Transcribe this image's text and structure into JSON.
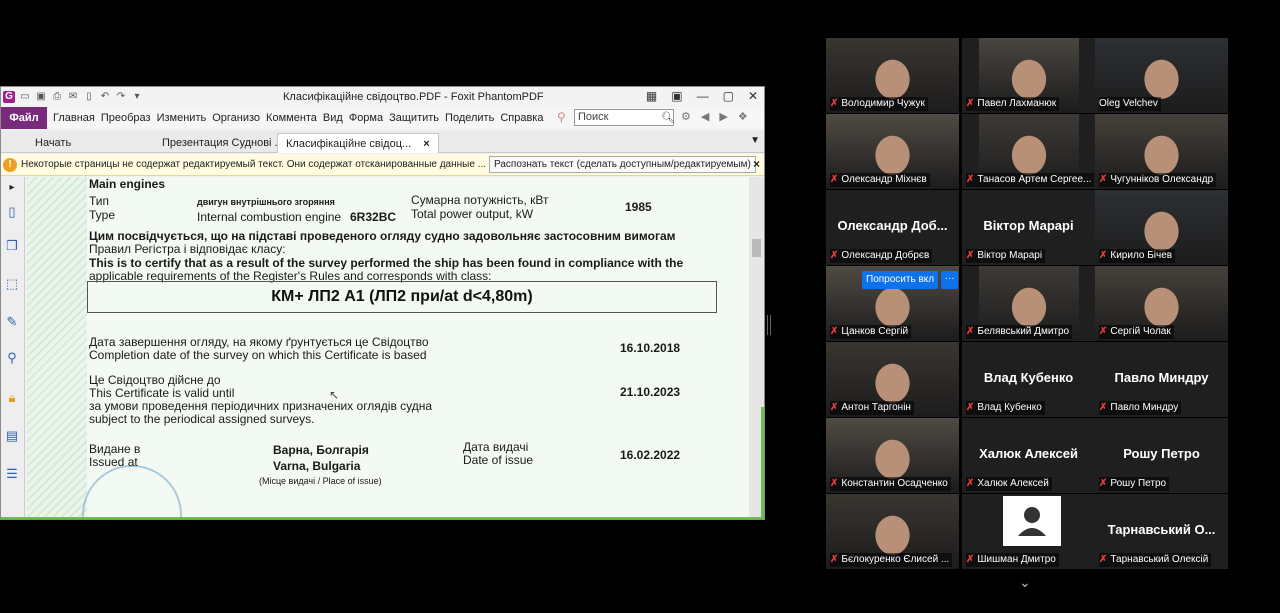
{
  "pdf_window": {
    "title": "Класифікаційне  свідоцтво.PDF - Foxit PhantomPDF",
    "menu": [
      "Файл",
      "Главная",
      "Преобраз",
      "Изменить",
      "Организо",
      "Коммента",
      "Вид",
      "Форма",
      "Защитить",
      "Поделить",
      "Справка"
    ],
    "search_placeholder": "Поиск",
    "tabs": [
      {
        "label": "Начать",
        "active": false
      },
      {
        "label": "Презентация Суднові ...",
        "active": false
      },
      {
        "label": "Класифікаційне  свідоц...",
        "active": true
      }
    ],
    "tab_close": "×",
    "infobar_text": "Некоторые страницы не содержат редактируемый текст. Они содержат отсканированные данные ...",
    "ocr_button": "Распознать текст (сделать доступным/редактируемым)",
    "infobar_close": "×"
  },
  "document": {
    "heading": "Main engines",
    "type_ua": "Тип",
    "type_en": "Type",
    "engine_ua": "двигун внутрішнього згоряння",
    "engine_en": "Internal combustion engine",
    "engine_model": "6R32BC",
    "power_ua": "Сумарна потужність, кВт",
    "power_en": "Total power output, kW",
    "power_value": "1985",
    "certify_ua_1": "Цим посвідчується, що на підставі проведеного огляду судно задовольняє застосовним вимогам",
    "certify_ua_2": "Правил Регістра і відповідає класу:",
    "certify_en_1": "This is to certify that as a result of the survey performed the ship has been found in compliance with the",
    "certify_en_2": "applicable requirements of the Register's Rules and corresponds with class:",
    "class_notation": "КМ+  ЛП2 А1 (ЛП2 при/at d<4,80m)",
    "completion_ua": "Дата завершення огляду, на якому ґрунтується це Свідоцтво",
    "completion_en": "Completion date of the survey on which this Certificate is based",
    "completion_date": "16.10.2018",
    "valid_ua": "Це Свідоцтво дійсне до",
    "valid_en": "This Certificate is valid until",
    "valid_date": "21.10.2023",
    "cond_ua": "за умови проведення періодичних призначених оглядів судна",
    "cond_en": "subject to the periodical assigned surveys.",
    "issued_ua": "Видане в",
    "issued_en": "Issued at",
    "place_ua": "Варна, Болгарія",
    "place_en": "Varna, Bulgaria",
    "place_caption": "(Місце видачі / Place of issue)",
    "issue_date_ua": "Дата видачі",
    "issue_date_en": "Date of issue",
    "issue_date": "16.02.2022"
  },
  "gallery": {
    "ask_button": "Попросить вкл",
    "more_button": "···",
    "tiles": [
      {
        "name": "Володимир Чужук",
        "big": "",
        "video": true
      },
      {
        "name": "Павел Лахманюк",
        "big": "",
        "video": true
      },
      {
        "name": "Oleg Velchev",
        "big": "",
        "video": true,
        "speaking": true
      },
      {
        "name": "Олександр Міхнєв",
        "big": "",
        "video": true
      },
      {
        "name": "Танасов Артем Сергее...",
        "big": "",
        "video": true
      },
      {
        "name": "Чугунніков Олександр",
        "big": "",
        "video": true
      },
      {
        "name": "Олександр Добрєв",
        "big": "Олександр  Доб...",
        "video": false
      },
      {
        "name": "Віктор Марарі",
        "big": "Віктор Марарі",
        "video": false
      },
      {
        "name": "Кирило Бічев",
        "big": "",
        "video": true
      },
      {
        "name": "Цанков Сергій",
        "big": "",
        "video": true
      },
      {
        "name": "Белявський Дмитро",
        "big": "",
        "video": true
      },
      {
        "name": "Сергій Чолак",
        "big": "",
        "video": true
      },
      {
        "name": "Антон Таргонін",
        "big": "",
        "video": true
      },
      {
        "name": "Влад Кубенко",
        "big": "Влад Кубенко",
        "video": false
      },
      {
        "name": "Павло Миндру",
        "big": "Павло Миндру",
        "video": false
      },
      {
        "name": "Константин Осадченко",
        "big": "",
        "video": true
      },
      {
        "name": "Халюк Алексей",
        "big": "Халюк Алексей",
        "video": false
      },
      {
        "name": "Рошу Петро",
        "big": "Рошу Петро",
        "video": false
      },
      {
        "name": "Бєлокуренко Єлисей ...",
        "big": "",
        "video": true
      },
      {
        "name": "Шишман Дмитро",
        "big": "",
        "video": false,
        "avatar": true
      },
      {
        "name": "Тарнавський Олексій",
        "big": "Тарнавський  О...",
        "video": false
      }
    ]
  }
}
